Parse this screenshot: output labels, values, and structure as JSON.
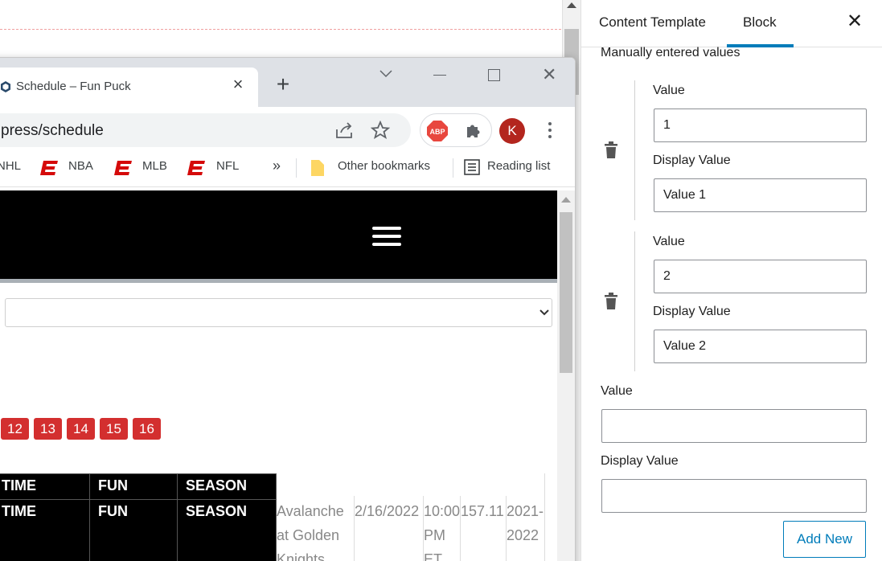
{
  "browser": {
    "tab_title": "Schedule – Fun Puck",
    "url": "press/schedule",
    "avatar_letter": "K",
    "abp_label": "ABP",
    "more_glyph": "»",
    "bookmarks": [
      {
        "label": "NHL"
      },
      {
        "label": "NBA"
      },
      {
        "label": "MLB"
      },
      {
        "label": "NFL"
      }
    ],
    "other_bookmarks": "Other bookmarks",
    "reading_list": "Reading list"
  },
  "webpage": {
    "pagination": [
      "12",
      "13",
      "14",
      "15",
      "16"
    ],
    "table_headers_row1": [
      "TIME",
      "FUN",
      "SEASON"
    ],
    "table_headers_row2": [
      "TIME",
      "FUN",
      "SEASON"
    ],
    "row": {
      "matchup_line1": "Avalanche",
      "matchup_line2": "at Golden",
      "matchup_line3": "Knights",
      "date": "2/16/2022",
      "time_line1": "10:00",
      "time_line2": "PM",
      "time_line3": "ET",
      "fun": "157.11",
      "season_line1": "2021-",
      "season_line2": "2022"
    }
  },
  "sidebar": {
    "tabs": [
      "Content Template",
      "Block"
    ],
    "active_tab": "Block",
    "section_title": "Manually entered values",
    "entries": [
      {
        "value_label": "Value",
        "value": "1",
        "display_label": "Display Value",
        "display": "Value 1"
      },
      {
        "value_label": "Value",
        "value": "2",
        "display_label": "Display Value",
        "display": "Value 2"
      }
    ],
    "new_entry": {
      "value_label": "Value",
      "value": "",
      "display_label": "Display Value",
      "display": ""
    },
    "add_new_label": "Add New"
  },
  "colors": {
    "accent": "#007cba",
    "pager_red": "#d32f2f",
    "avatar_red": "#b3261e"
  }
}
